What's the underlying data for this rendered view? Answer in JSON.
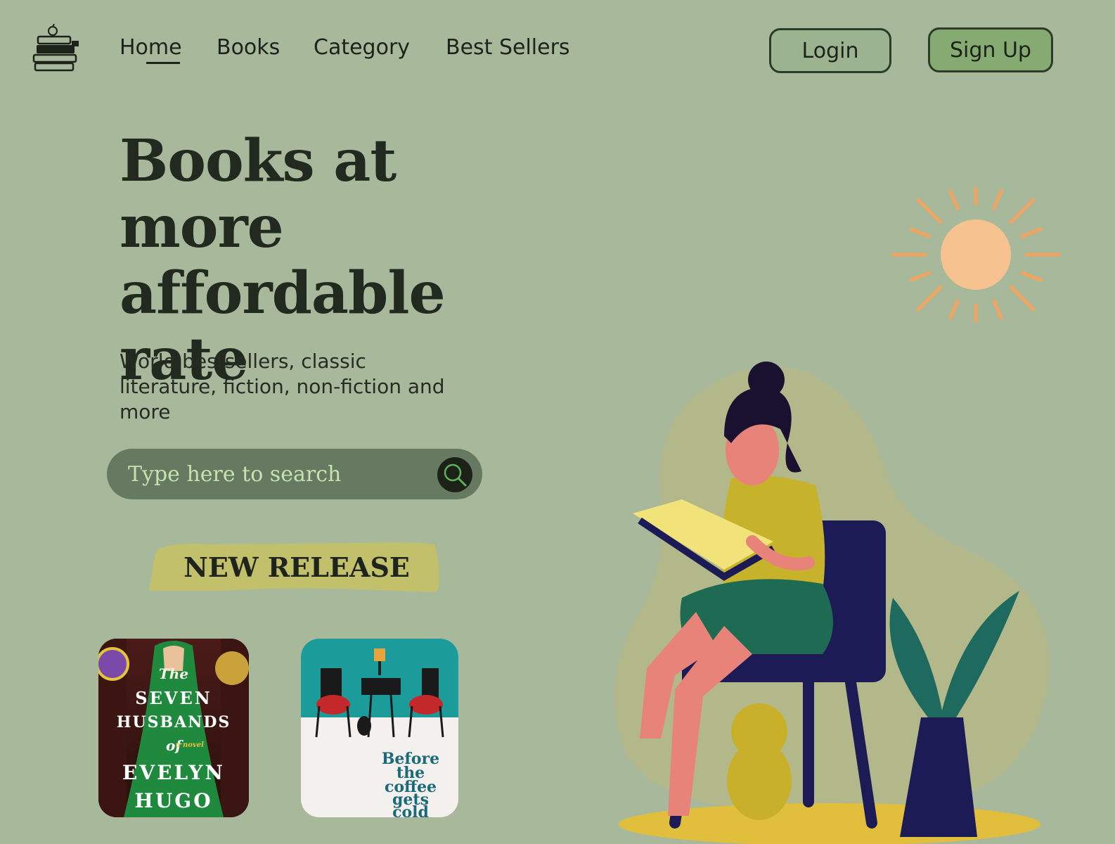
{
  "nav": {
    "items": [
      "Home",
      "Books",
      "Category",
      "Best Sellers"
    ],
    "active": "Home"
  },
  "auth": {
    "login_label": "Login",
    "signup_label": "Sign Up"
  },
  "hero": {
    "headline_line1": "Books at more",
    "headline_line2": "affordable",
    "headline_line3": "rate",
    "subtext": "World bestsellers, classic literature, fiction, non-fiction and more"
  },
  "search": {
    "placeholder": "Type here to search"
  },
  "section": {
    "new_release_label": "NEW RELEASE"
  },
  "books": [
    {
      "title_lines": [
        "The",
        "SEVEN",
        "HUSBANDS",
        "of",
        "EVELYN",
        "HUGO"
      ],
      "tag": "a novel"
    },
    {
      "title_lines": [
        "Before",
        "the",
        "coffee",
        "gets",
        "cold"
      ]
    }
  ],
  "colors": {
    "background": "#a8b89b",
    "login_button": "#9bb48f",
    "signup_button": "#86ab72",
    "search_bar": "#667a62",
    "ribbon": "#c2c06a",
    "sun": "#f6c390"
  },
  "icons": [
    "book-stack-logo-icon",
    "search-icon",
    "sun-illustration"
  ]
}
